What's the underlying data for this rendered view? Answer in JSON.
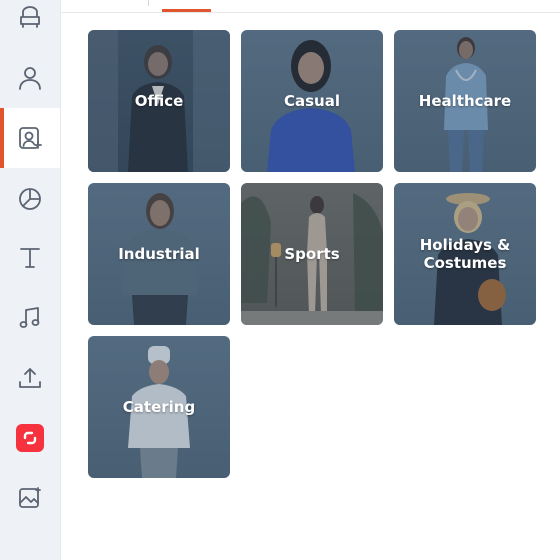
{
  "sidebar": {
    "items": [
      {
        "icon": "avatar-seat-icon",
        "name": "sidebar-item-avatars"
      },
      {
        "icon": "person-icon",
        "name": "sidebar-item-characters"
      },
      {
        "icon": "person-photo-icon",
        "name": "sidebar-item-presenters",
        "active": true
      },
      {
        "icon": "pie-chart-icon",
        "name": "sidebar-item-charts"
      },
      {
        "icon": "text-icon",
        "name": "sidebar-item-text"
      },
      {
        "icon": "music-note-icon",
        "name": "sidebar-item-music"
      },
      {
        "icon": "upload-icon",
        "name": "sidebar-item-upload"
      },
      {
        "icon": "app-logo-icon",
        "name": "sidebar-item-app"
      },
      {
        "icon": "ai-image-icon",
        "name": "sidebar-item-ai-image"
      }
    ]
  },
  "accent_color": "#e0542e",
  "categories": [
    {
      "label": "Office"
    },
    {
      "label": "Casual"
    },
    {
      "label": "Healthcare"
    },
    {
      "label": "Industrial"
    },
    {
      "label": "Sports"
    },
    {
      "label": "Holidays & Costumes"
    },
    {
      "label": "Catering"
    }
  ]
}
